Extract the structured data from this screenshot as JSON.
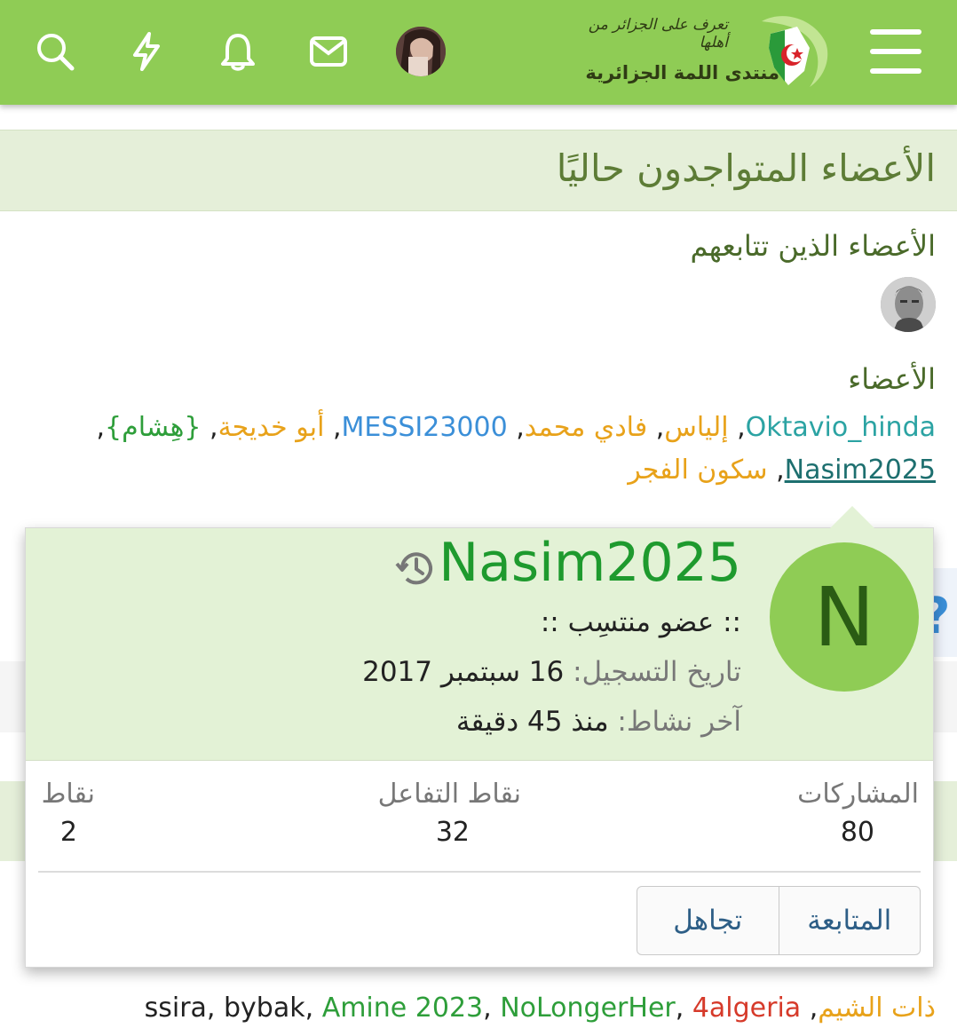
{
  "header": {
    "logo_tagline": "تعرف على الجزائر من أهلها",
    "logo_name": "منتدى اللمة الجزائرية",
    "icons": [
      "menu-icon",
      "search-icon",
      "lightning-icon",
      "bell-icon",
      "mail-icon"
    ],
    "accent_color": "#8fcc55"
  },
  "page": {
    "title": "الأعضاء المتواجدون حاليًا",
    "followed_title": "الأعضاء الذين تتابعهم",
    "members_title": "الأعضاء",
    "members_line1": [
      {
        "name": "Oktavio_hinda",
        "color": "#2ba3a3"
      },
      {
        "name": "إلياس",
        "color": "#e8a21a"
      },
      {
        "name": "فادي محمد",
        "color": "#e8a21a"
      },
      {
        "name": "MESSI23000",
        "color": "#3b8fd8"
      },
      {
        "name": "أبو خديجة",
        "color": "#e8a21a"
      },
      {
        "name": "{هِشام}",
        "color": "#2e9e3a"
      }
    ],
    "members_line2": [
      {
        "name": "Nasim2025",
        "color": "#1d6f6f"
      },
      {
        "name": "سكون الفجر",
        "color": "#e8a21a"
      }
    ],
    "bottom_line": [
      {
        "name": "ذات الشيم",
        "color": "#e8a21a"
      },
      {
        "name": "ssira",
        "color": "#222222"
      },
      {
        "name": "bybak",
        "color": "#222222"
      },
      {
        "name": "Amine 2023",
        "color": "#2e9e3a"
      },
      {
        "name": "NoLongerHer",
        "color": "#2e9e3a"
      },
      {
        "name": "4algeria",
        "color": "#d63a2a"
      }
    ],
    "blue_stub_char": "?"
  },
  "popup": {
    "avatar_letter": "N",
    "username": "Nasim2025",
    "rank": ":: عضو منتسِب ::",
    "registered_label": "تاريخ التسجيل:",
    "registered_value": "16 سبتمبر 2017",
    "last_active_label": "آخر نشاط:",
    "last_active_value": "منذ 45 دقيقة",
    "stats": {
      "posts_label": "المشاركات",
      "posts_value": "80",
      "reactions_label": "نقاط التفاعل",
      "reactions_value": "32",
      "points_label": "نقاط",
      "points_value": "2"
    },
    "follow_label": "المتابعة",
    "ignore_label": "تجاهل"
  }
}
